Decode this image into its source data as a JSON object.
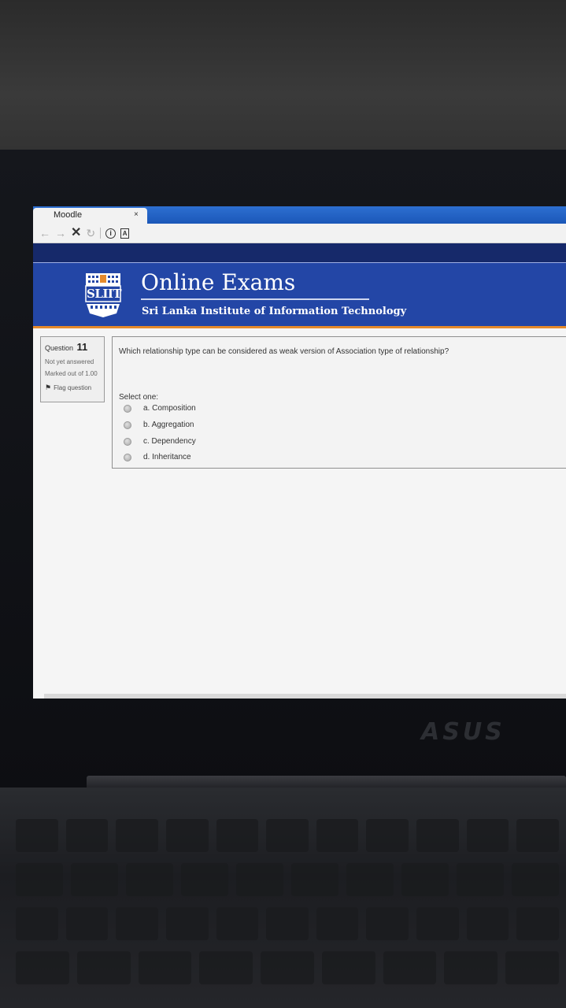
{
  "browser": {
    "tab_title": "Moodle",
    "tab_close": "×"
  },
  "header": {
    "logo_text": "SLIIT",
    "title": "Online Exams",
    "subtitle": "Sri Lanka Institute of Information Technology"
  },
  "question_info": {
    "label": "Question",
    "number": "11",
    "status": "Not yet answered",
    "marked": "Marked out of 1.00",
    "flag_label": "Flag question"
  },
  "question": {
    "text": "Which relationship type can be considered as weak version of Association type of relationship?",
    "prompt": "Select one:",
    "options": [
      {
        "label": "a. Composition"
      },
      {
        "label": "b. Aggregation"
      },
      {
        "label": "c. Dependency"
      },
      {
        "label": "d. Inheritance"
      }
    ]
  },
  "device": {
    "brand": "ASUS"
  }
}
